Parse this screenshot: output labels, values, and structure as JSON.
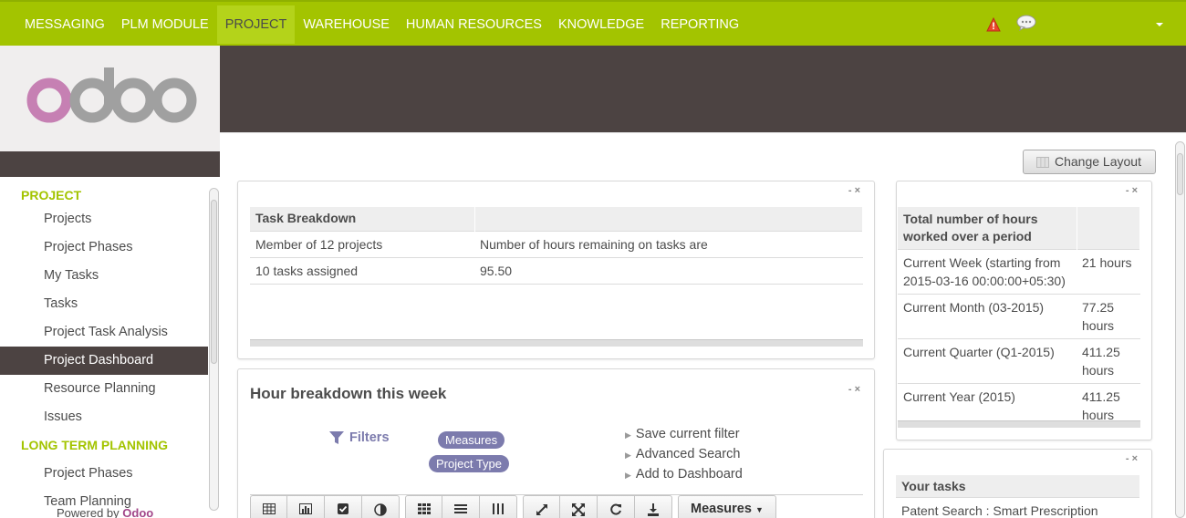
{
  "top_menu": [
    "MESSAGING",
    "PLM MODULE",
    "PROJECT",
    "WAREHOUSE",
    "HUMAN RESOURCES",
    "KNOWLEDGE",
    "REPORTING"
  ],
  "active_top_menu": "PROJECT",
  "sidebar": {
    "sections": [
      {
        "title": "PROJECT",
        "items": [
          "Projects",
          "Project Phases",
          "My Tasks",
          "Tasks",
          "Project Task Analysis",
          "Project Dashboard",
          "Resource Planning",
          "Issues"
        ]
      },
      {
        "title": "LONG TERM PLANNING",
        "items": [
          "Project Phases",
          "Team Planning"
        ]
      }
    ],
    "active_item": "Project Dashboard",
    "powered_by": "Powered by",
    "powered_brand": "Odoo"
  },
  "change_layout_label": "Change Layout",
  "task_breakdown": {
    "headers": [
      "Task Breakdown",
      ""
    ],
    "rows": [
      [
        "Member of 12 projects",
        "Number of hours remaining on tasks are"
      ],
      [
        "10 tasks assigned",
        "95.50"
      ]
    ]
  },
  "hour_breakdown": {
    "title": "Hour breakdown this week",
    "filters_label": "Filters",
    "tags": [
      "Measures",
      "Project Type"
    ],
    "options": [
      "Save current filter",
      "Advanced Search",
      "Add to Dashboard"
    ],
    "measures_button": "Measures"
  },
  "hours_table": {
    "header": "Total number of hours worked over a period",
    "rows": [
      [
        "Current Week (starting from 2015-03-16 00:00:00+05:30)",
        "21 hours"
      ],
      [
        "Current Month (03-2015)",
        "77.25 hours"
      ],
      [
        "Current Quarter (Q1-2015)",
        "411.25 hours"
      ],
      [
        "Current Year (2015)",
        "411.25 hours"
      ]
    ]
  },
  "your_tasks": {
    "header": "Your tasks",
    "rows": [
      "Patent Search : Smart Prescription"
    ]
  },
  "colors": {
    "topbar": "#a3c400",
    "dark": "#4c4342",
    "accent_green": "#a3c400",
    "tag": "#7c7bad",
    "brand_pink": "#a24689"
  }
}
